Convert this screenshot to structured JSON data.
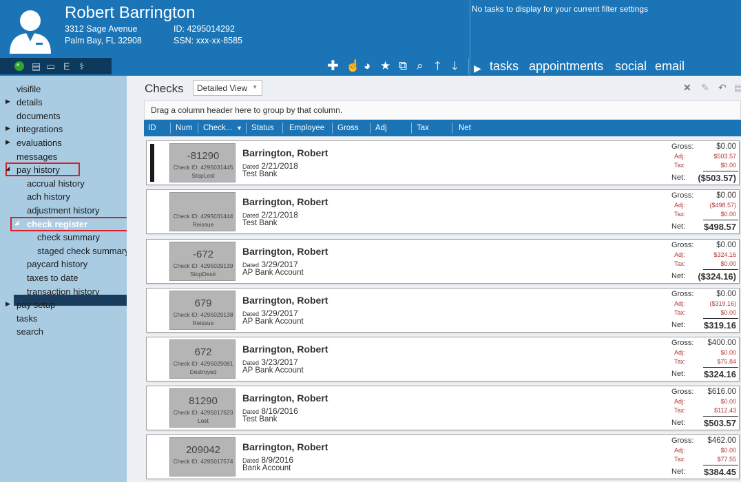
{
  "employee": {
    "name": "Robert Barrington",
    "address1": "3312 Sage Avenue",
    "address2": "Palm Bay, FL 32908",
    "id_label": "ID: 4295014292",
    "ssn_label": "SSN: xxx-xx-8585"
  },
  "header_icons": [
    "status-dot-icon",
    "document-icon",
    "card-icon",
    "E",
    "caduceus-icon"
  ],
  "tasks_message": "No tasks to display for your current filter settings",
  "header_tabs": [
    "tasks",
    "appointments",
    "social",
    "email"
  ],
  "sidebar": [
    {
      "label": "visifile"
    },
    {
      "label": "details",
      "expandable": true
    },
    {
      "label": "documents"
    },
    {
      "label": "integrations",
      "expandable": true
    },
    {
      "label": "evaluations",
      "expandable": true
    },
    {
      "label": "messages"
    },
    {
      "label": "pay history",
      "expanded": true,
      "highlighted": true
    },
    {
      "label": "accrual history"
    },
    {
      "label": "ach history"
    },
    {
      "label": "adjustment history"
    },
    {
      "label": "check register",
      "selected": true,
      "highlighted": true
    },
    {
      "label": "check summary"
    },
    {
      "label": "staged check summary"
    },
    {
      "label": "paycard history"
    },
    {
      "label": "taxes to date"
    },
    {
      "label": "transaction history"
    },
    {
      "label": "pay setup",
      "expandable": true
    },
    {
      "label": "tasks"
    },
    {
      "label": "search"
    }
  ],
  "checks": {
    "title": "Checks",
    "view": "Detailed View",
    "group_hint": "Drag a column header here to group by that column.",
    "columns": [
      "ID",
      "Num",
      "Check...",
      "Status",
      "Employee",
      "Gross",
      "Adj",
      "Tax",
      "Net"
    ],
    "labels": {
      "gross": "Gross:",
      "adj": "Adj:",
      "tax": "Tax:",
      "net": "Net:",
      "dated": "Dated"
    },
    "rows": [
      {
        "num": "-81290",
        "check_id": "Check ID: 4295031445",
        "status": "StopLost",
        "name": "Barrington, Robert",
        "date": "2/21/2018",
        "bank": "Test Bank",
        "gross": "$0.00",
        "adj": "$503.57",
        "tax": "$0.00",
        "net": "($503.57)"
      },
      {
        "num": "",
        "check_id": "Check ID: 4295031444",
        "status": "Reissue",
        "name": "Barrington, Robert",
        "date": "2/21/2018",
        "bank": "Test Bank",
        "gross": "$0.00",
        "adj": "($498.57)",
        "tax": "$0.00",
        "net": "$498.57"
      },
      {
        "num": "-672",
        "check_id": "Check ID: 4295029139",
        "status": "StopDestr",
        "name": "Barrington, Robert",
        "date": "3/29/2017",
        "bank": "AP Bank Account",
        "gross": "$0.00",
        "adj": "$324.16",
        "tax": "$0.00",
        "net": "($324.16)"
      },
      {
        "num": "679",
        "check_id": "Check ID: 4295029138",
        "status": "Reissue",
        "name": "Barrington, Robert",
        "date": "3/29/2017",
        "bank": "AP Bank Account",
        "gross": "$0.00",
        "adj": "($319.16)",
        "tax": "$0.00",
        "net": "$319.16"
      },
      {
        "num": "672",
        "check_id": "Check ID: 4295029081",
        "status": "Destroyed",
        "name": "Barrington, Robert",
        "date": "3/23/2017",
        "bank": "AP Bank Account",
        "gross": "$400.00",
        "adj": "$0.00",
        "tax": "$75.84",
        "net": "$324.16"
      },
      {
        "num": "81290",
        "check_id": "Check ID: 4295017623",
        "status": "Lost",
        "name": "Barrington, Robert",
        "date": "8/16/2016",
        "bank": "Test Bank",
        "gross": "$616.00",
        "adj": "$0.00",
        "tax": "$112.43",
        "net": "$503.57"
      },
      {
        "num": "209042",
        "check_id": "Check ID: 4295017574",
        "status": "",
        "name": "Barrington, Robert",
        "date": "8/9/2016",
        "bank": "Bank Account",
        "gross": "$462.00",
        "adj": "$0.00",
        "tax": "$77.55",
        "net": "$384.45"
      }
    ]
  },
  "colors": {
    "header": "#1b74b5",
    "sidebar": "#a9cce3",
    "highlight": "#d9202a",
    "selected": "#1a3d5e",
    "adjustment_text": "#b03535"
  }
}
